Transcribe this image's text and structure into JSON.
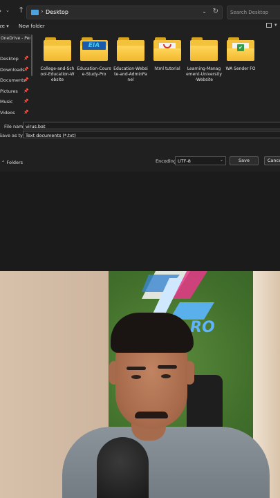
{
  "nav": {
    "back_glyph": "‹",
    "fwd_glyph": "›",
    "up_glyph": "↑"
  },
  "address": {
    "path": "Desktop"
  },
  "search": {
    "placeholder": "Search Desktop"
  },
  "toolbar": {
    "organize_label": "ze ▾",
    "new_folder_label": "New folder"
  },
  "sidebar": {
    "onedrive_label": "OneDrive - Perso",
    "items": [
      {
        "label": "Desktop"
      },
      {
        "label": "Downloads"
      },
      {
        "label": "Documents"
      },
      {
        "label": "Pictures"
      },
      {
        "label": "Music"
      },
      {
        "label": "Videos"
      }
    ]
  },
  "files": [
    {
      "name": "College-and-School-Education-Website",
      "display": "College-and-Sch\nool-Education-W\nebsite",
      "thumb": "folder"
    },
    {
      "name": "Education-Course-Study-Pro",
      "display": "Education-Cours\ne-Study-Pro",
      "thumb": "folder-logo",
      "logo_text": "EIA"
    },
    {
      "name": "Education-Website-and-AdminPanel",
      "display": "Education-Websi\nte-and-AdminPa\nnel",
      "thumb": "folder"
    },
    {
      "name": "html tutorial",
      "display": "html tutorial",
      "thumb": "folder-red"
    },
    {
      "name": "Learning-Management-University-Website",
      "display": "Learning-Manag\nement-University\n-Website",
      "thumb": "folder"
    },
    {
      "name": "WA Sender FO",
      "display": "WA Sender FO",
      "thumb": "folder-green"
    }
  ],
  "form": {
    "filename_label": "File name:",
    "filename_value": "virus.bat",
    "savetype_label": "Save as type:",
    "savetype_value": "Text documents (*.txt)",
    "hide_folders_label": "Folders",
    "encoding_label": "Encoding:",
    "encoding_value": "UTF-8",
    "save_label": "Save",
    "cancel_label": "Cance"
  },
  "video_overlay": {
    "logo_text": "RO"
  }
}
